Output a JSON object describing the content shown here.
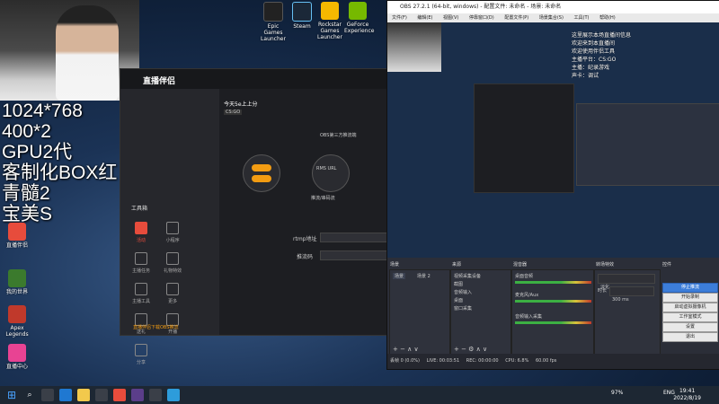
{
  "overlay": {
    "lines": [
      "1024*768",
      "400*2",
      "GPU2代",
      "客制化BOX红",
      "青髓2",
      "宝美S"
    ]
  },
  "desktop_icons_top": [
    {
      "label": "Epic Games Launcher",
      "color": "#222222"
    },
    {
      "label": "Steam",
      "color": "#1b2838"
    },
    {
      "label": "Rockstar Games Launcher",
      "color": "#f5b800"
    },
    {
      "label": "GeForce Experience",
      "color": "#76b900"
    }
  ],
  "desktop_icons_left": [
    {
      "label": "直播伴侣",
      "color": "#e74c3c"
    },
    {
      "label": "我的世界",
      "color": "#3b7a2d"
    },
    {
      "label": "Apex Legends",
      "color": "#c0392b"
    },
    {
      "label": "直播中心",
      "color": "#e84393"
    }
  ],
  "streaming_app": {
    "logo": "直播伴侣",
    "stream_title": "今天5e上上分",
    "category": "CS:GO",
    "step1": "进入",
    "step2": "RMS URL",
    "step2_sub": "推流/串码流",
    "obs_label": "OBS第三方推流端",
    "rtmp_label": "rtmp地址",
    "key_label": "推流码",
    "toolbox_label": "工具箱",
    "tools": [
      "活动",
      "小程序",
      "主播任务",
      "礼物特效",
      "主播工具",
      "更多",
      "送礼",
      "开播",
      "分享"
    ],
    "footer_note": "直播伴侣下载OBS推流"
  },
  "obs": {
    "title": "OBS 27.2.1 (64-bit, windows) - 配置文件: 未命名 - 场景: 未命名",
    "menu": [
      "文件(F)",
      "编辑(E)",
      "视图(V)",
      "停靠窗口(D)",
      "配置文件(P)",
      "场景集合(S)",
      "工具(T)",
      "帮助(H)"
    ],
    "docks": {
      "scenes": "场景",
      "sources": "来源",
      "mixer": "混音器",
      "transitions": "转场特效",
      "controls": "控件"
    },
    "scene_items": [
      "场景",
      "场景 2"
    ],
    "source_items": [
      "视频采集设备",
      "截图",
      "音频输入",
      "桌面",
      "窗口采集"
    ],
    "mixer_items": [
      "桌面音频",
      "麦克风/Aux",
      "音频输入采集"
    ],
    "transition": "淡化",
    "duration_label": "时长",
    "duration_value": "300 ms",
    "buttons": [
      "停止推流",
      "开始录制",
      "启动虚拟摄像机",
      "工作室模式",
      "设置",
      "退出"
    ],
    "status": {
      "dropped": "丢帧 0 (0.0%)",
      "live": "LIVE: 00:03:51",
      "rec": "REC: 00:00:00",
      "cpu": "CPU: 6.8%",
      "fps": "60.00 fps"
    }
  },
  "right_notes": [
    "这里展示本场直播间信息",
    "欢迎来到本直播间",
    "欢迎使用伴侣工具",
    "主播平台：CS:GO",
    "主播：纪录游戏",
    "声卡：调试"
  ],
  "taskbar": {
    "time": "19:41",
    "date": "2022/8/19",
    "lang": "ENG",
    "battery": "97%"
  }
}
